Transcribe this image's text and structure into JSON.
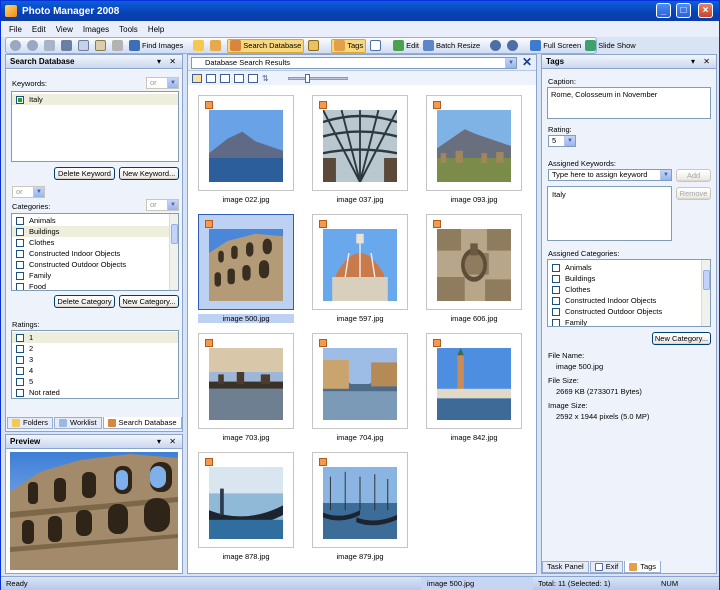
{
  "window": {
    "title": "Photo Manager 2008"
  },
  "menu": [
    "File",
    "Edit",
    "View",
    "Images",
    "Tools",
    "Help"
  ],
  "toolbar": {
    "find_images": "Find Images",
    "search_database": "Search Database",
    "tags": "Tags",
    "edit": "Edit",
    "batch_resize": "Batch Resize",
    "full_screen": "Full Screen",
    "slide_show": "Slide Show"
  },
  "search_panel": {
    "title": "Search Database",
    "keywords_label": "Keywords:",
    "keyword_mode": "or",
    "keywords": [
      "Italy"
    ],
    "delete_keyword": "Delete Keyword",
    "new_keyword": "New Keyword...",
    "category_join": "or",
    "categories_label": "Categories:",
    "category_mode": "or",
    "categories": [
      "Animals",
      "Buildings",
      "Clothes",
      "Constructed Indoor Objects",
      "Constructed Outdoor Objects",
      "Family",
      "Food"
    ],
    "delete_category": "Delete Category",
    "new_category": "New Category...",
    "ratings_label": "Ratings:",
    "ratings": [
      "1",
      "2",
      "3",
      "4",
      "5",
      "Not rated"
    ]
  },
  "left_tabs": [
    "Folders",
    "Worklist",
    "Search Database"
  ],
  "preview": {
    "title": "Preview"
  },
  "center": {
    "dropdown": "Database Search Results",
    "thumbnails": [
      {
        "name": "image 022.jpg",
        "scene": "sea-mountain"
      },
      {
        "name": "image 037.jpg",
        "scene": "gallery"
      },
      {
        "name": "image 093.jpg",
        "scene": "ruins-mountain"
      },
      {
        "name": "image 500.jpg",
        "scene": "colosseum"
      },
      {
        "name": "image 597.jpg",
        "scene": "dome"
      },
      {
        "name": "image 606.jpg",
        "scene": "stone-ring"
      },
      {
        "name": "image 703.jpg",
        "scene": "river-sunset"
      },
      {
        "name": "image 704.jpg",
        "scene": "canal"
      },
      {
        "name": "image 842.jpg",
        "scene": "venice-tower"
      },
      {
        "name": "image 878.jpg",
        "scene": "gondola"
      },
      {
        "name": "image 879.jpg",
        "scene": "gondolas"
      }
    ],
    "selected_index": 3
  },
  "tags_panel": {
    "title": "Tags",
    "caption_label": "Caption:",
    "caption_value": "Rome, Colosseum in November",
    "rating_label": "Rating:",
    "rating_value": "5",
    "assigned_keywords_label": "Assigned Keywords:",
    "keyword_placeholder": "Type here to assign keyword",
    "add_button": "Add",
    "remove_button": "Remove",
    "assigned_keywords": [
      "Italy"
    ],
    "assigned_categories_label": "Assigned Categories:",
    "categories": [
      "Animals",
      "Buildings",
      "Clothes",
      "Constructed Indoor Objects",
      "Constructed Outdoor Objects",
      "Family"
    ],
    "new_category": "New Category...",
    "file_name_label": "File Name:",
    "file_name": "image 500.jpg",
    "file_size_label": "File Size:",
    "file_size": "2669 KB (2733071 Bytes)",
    "image_size_label": "Image Size:",
    "image_size": "2592 x 1944 pixels (5.0 MP)"
  },
  "right_tabs": [
    "Task Panel",
    "Exif",
    "Tags"
  ],
  "status": {
    "left": "Ready",
    "file": "image 500.jpg",
    "total": "Total: 11 (Selected: 1)",
    "num": "NUM"
  }
}
